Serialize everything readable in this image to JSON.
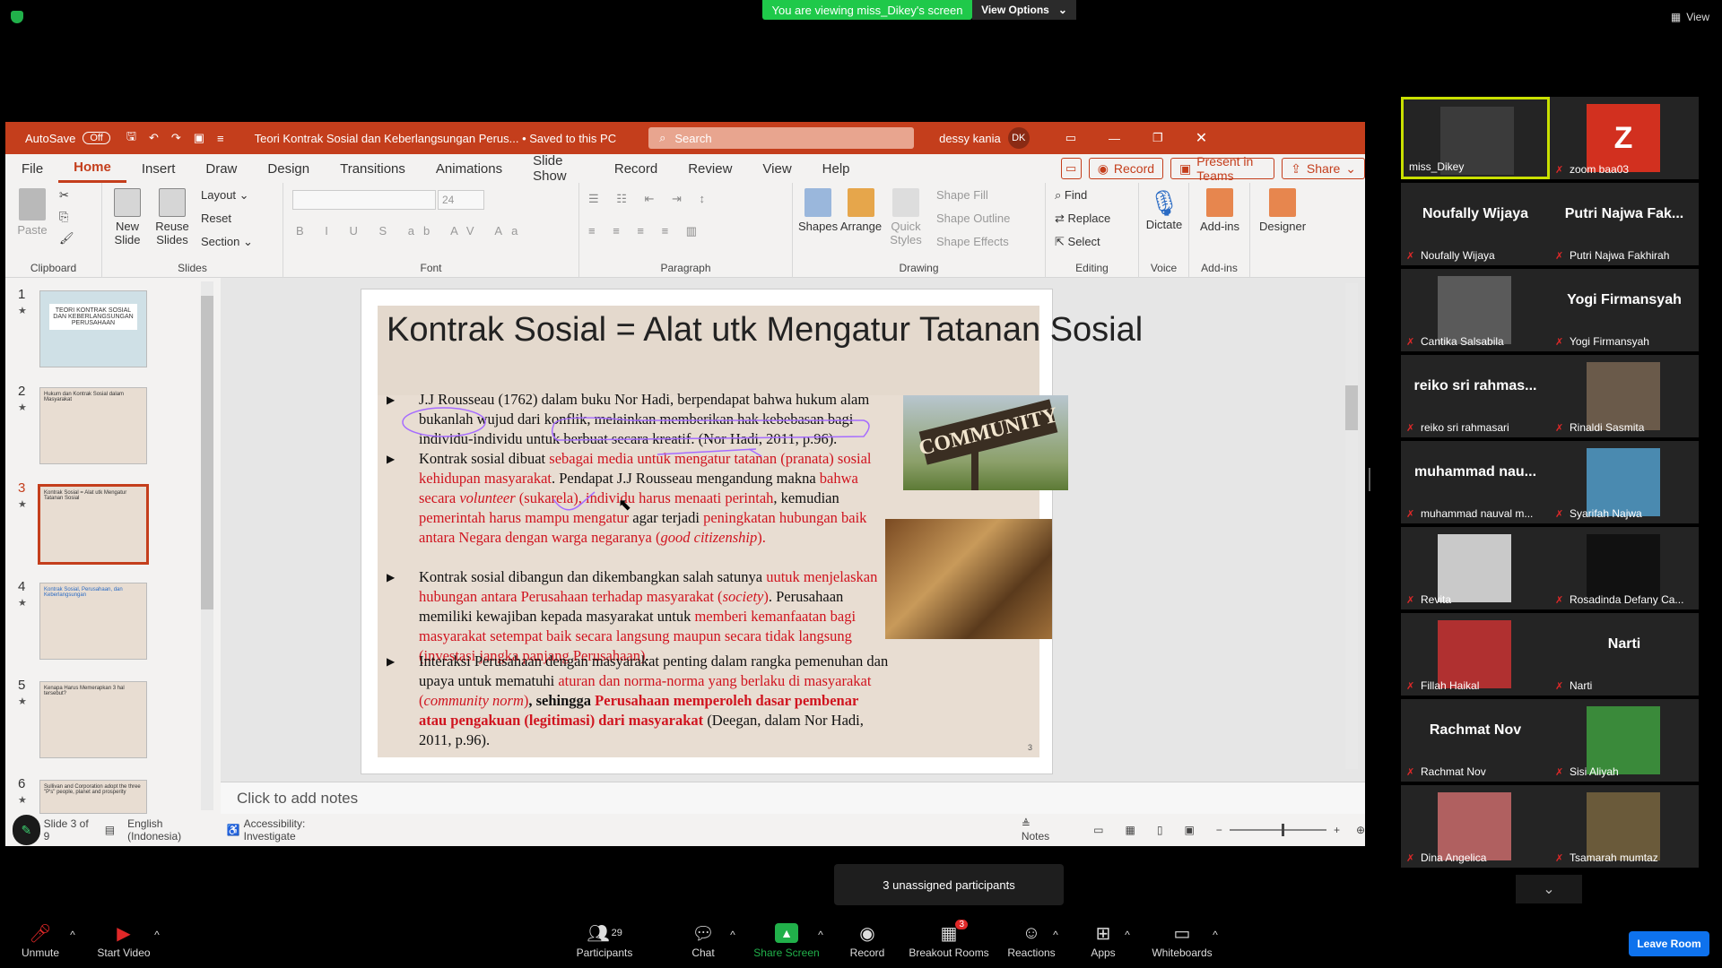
{
  "zoom": {
    "banner": "You are viewing miss_Dikey's screen",
    "view_options": "View Options",
    "view_label": "View",
    "toolbar": {
      "unmute": "Unmute",
      "start_video": "Start Video",
      "participants": "Participants",
      "participants_count": "29",
      "chat": "Chat",
      "share_screen": "Share Screen",
      "record": "Record",
      "breakout_rooms": "Breakout Rooms",
      "breakout_badge": "3",
      "reactions": "Reactions",
      "apps": "Apps",
      "whiteboards": "Whiteboards",
      "leave": "Leave Room"
    },
    "tooltip": "3 unassigned participants",
    "participants": [
      {
        "name": "miss_Dikey",
        "big": "",
        "video": true
      },
      {
        "name": "zoom baa03",
        "big": "Z",
        "video": false
      },
      {
        "name": "Noufally Wijaya",
        "big": "Noufally Wijaya",
        "video": false
      },
      {
        "name": "Putri Najwa Fakhirah",
        "big": "Putri Najwa Fak...",
        "video": false
      },
      {
        "name": "Cantika Salsabila",
        "big": "",
        "video": true
      },
      {
        "name": "Yogi Firmansyah",
        "big": "Yogi Firmansyah",
        "video": false
      },
      {
        "name": "reiko sri rahmasari",
        "big": "reiko sri rahmas...",
        "video": false
      },
      {
        "name": "Rinaldi Sasmita",
        "big": "",
        "video": true
      },
      {
        "name": "muhammad nauval m...",
        "big": "muhammad nau...",
        "video": false
      },
      {
        "name": "Syarifah Najwa",
        "big": "",
        "video": true
      },
      {
        "name": "Revita",
        "big": "",
        "video": true
      },
      {
        "name": "Rosadinda Defany Ca...",
        "big": "",
        "video": true
      },
      {
        "name": "Fillah Haikal",
        "big": "",
        "video": true
      },
      {
        "name": "Narti",
        "big": "Narti",
        "video": false
      },
      {
        "name": "Rachmat Nov",
        "big": "Rachmat Nov",
        "video": false
      },
      {
        "name": "Sisi Aliyah",
        "big": "",
        "video": true
      },
      {
        "name": "Dina Angelica",
        "big": "",
        "video": true
      },
      {
        "name": "Tsamarah mumtaz",
        "big": "",
        "video": true
      }
    ]
  },
  "ppt": {
    "autosave": "AutoSave",
    "autosave_state": "Off",
    "doc_title": "Teori Kontrak Sosial dan Keberlangsungan Perus...  •  Saved to this PC",
    "search_placeholder": "Search",
    "user": "dessy kania",
    "user_initials": "DK",
    "menu": [
      "File",
      "Home",
      "Insert",
      "Draw",
      "Design",
      "Transitions",
      "Animations",
      "Slide Show",
      "Record",
      "Review",
      "View",
      "Help"
    ],
    "record_btn": "Record",
    "present_btn": "Present in Teams",
    "share_btn": "Share",
    "ribbon": {
      "paste": "Paste",
      "clipboard": "Clipboard",
      "new_slide": "New Slide",
      "reuse_slides": "Reuse Slides",
      "layout": "Layout",
      "reset": "Reset",
      "section": "Section",
      "slides": "Slides",
      "font_size": "24",
      "font": "Font",
      "paragraph": "Paragraph",
      "shapes": "Shapes",
      "arrange": "Arrange",
      "quick_styles": "Quick Styles",
      "shape_fill": "Shape Fill",
      "shape_outline": "Shape Outline",
      "shape_effects": "Shape Effects",
      "drawing": "Drawing",
      "find": "Find",
      "replace": "Replace",
      "select": "Select",
      "editing": "Editing",
      "dictate": "Dictate",
      "voice": "Voice",
      "addins": "Add-ins",
      "addins_group": "Add-ins",
      "designer": "Designer"
    },
    "thumbs": [
      {
        "num": "1",
        "text": "TEORI KONTRAK SOSIAL DAN KEBERLANGSUNGAN PERUSAHAAN"
      },
      {
        "num": "2",
        "text": "Hukum dan Kontrak Sosial dalam Masyarakat"
      },
      {
        "num": "3",
        "text": "Kontrak Sosial = Alat utk Mengatur Tatanan Sosial"
      },
      {
        "num": "4",
        "text": "Kontrak Sosial, Perusahaan, dan Keberlangsungan"
      },
      {
        "num": "5",
        "text": "Kenapa Harus Memerapkan 3 hal tersebut?"
      },
      {
        "num": "6",
        "text": "Sullivan and Corporation adopt the three \"P's\" people, planet and prosperity"
      }
    ],
    "slide": {
      "title": "Kontrak Sosial = Alat utk Mengatur Tatanan Sosial",
      "b1": "J.J Rousseau (1762) dalam buku Nor Hadi, berpendapat bahwa hukum alam bukanlah wujud dari konflik, melainkan memberikan hak kebebasan bagi individu-individu untuk berbuat secara kreatif. (Nor Hadi, 2011, p.96).",
      "b2_a": "Kontrak sosial dibuat ",
      "b2_b": "sebagai media untuk mengatur tatanan (pranata) sosial kehidupan masyarakat",
      "b2_c": ". Pendapat J.J Rousseau mengandung makna ",
      "b2_d": "bahwa secara ",
      "b2_e": "volunteer",
      "b2_f": " (sukarela), individu harus menaati perintah",
      "b2_g": ", kemudian ",
      "b2_h": "pemerintah harus mampu mengatur",
      "b2_i": " agar terjadi ",
      "b2_j": "peningkatan hubungan baik antara Negara dengan warga negaranya (",
      "b2_k": "good citizenship",
      "b2_l": ").",
      "b3_a": "Kontrak sosial dibangun dan dikembangkan salah satunya ",
      "b3_b": "uutuk menjelaskan hubungan antara Perusahaan terhadap masyarakat (",
      "b3_c": "society",
      "b3_d": ")",
      "b3_e": ". Perusahaan memiliki kewajiban kepada masyarakat untuk ",
      "b3_f": "memberi kemanfaatan bagi masyarakat setempat baik secara langsung maupun secara tidak langsung (investasi jangka panjang Perusahaan)",
      "b3_g": ".",
      "b4_a": "Interaksi Perusahaan dengan masyarakat penting dalam rangka pemenuhan dan upaya untuk mematuhi ",
      "b4_b": "aturan dan norma-norma yang berlaku di masyarakat (",
      "b4_c": "community norm",
      "b4_d": ")",
      "b4_e": ", sehingga ",
      "b4_f": "Perusahaan memperoleh dasar pembenar atau pengakuan (legitimasi) dari masyarakat",
      "b4_g": " (Deegan, dalam Nor Hadi, 2011, p.96).",
      "community_sign": "COMMUNITY",
      "page_num": "3"
    },
    "notes_placeholder": "Click to add notes",
    "status": {
      "slide_of": "Slide 3 of 9",
      "language": "English (Indonesia)",
      "accessibility": "Accessibility: Investigate",
      "notes": "Notes"
    }
  }
}
